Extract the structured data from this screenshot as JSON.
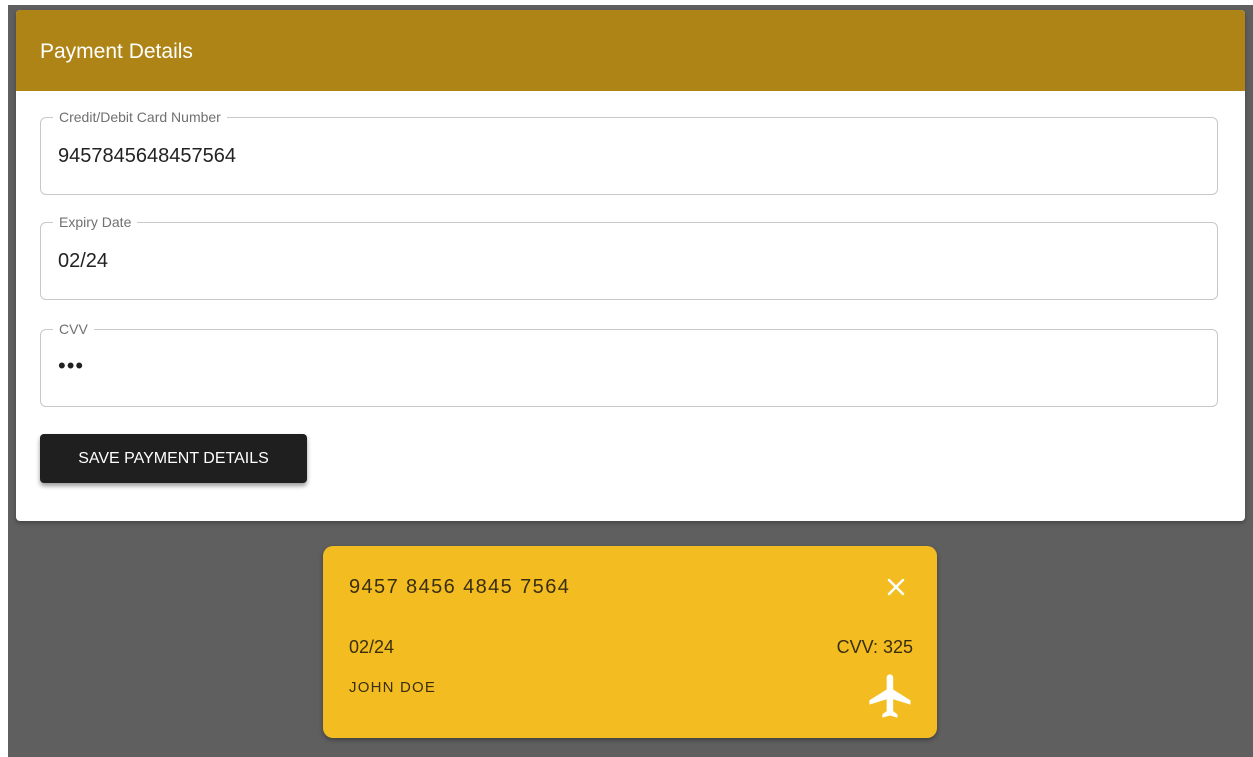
{
  "panel": {
    "title": "Payment Details"
  },
  "fields": {
    "card_number": {
      "label": "Credit/Debit Card Number",
      "value": "9457845648457564"
    },
    "expiry": {
      "label": "Expiry Date",
      "value": "02/24"
    },
    "cvv": {
      "label": "CVV",
      "value": "•••"
    }
  },
  "save_button": {
    "label": "SAVE PAYMENT DETAILS"
  },
  "card_preview": {
    "number": "9457 8456 4845 7564",
    "expiry": "02/24",
    "cvv_text": "CVV: 325",
    "holder": "JOHN DOE",
    "close_icon": "close-icon",
    "brand_icon": "airplane-icon"
  },
  "colors": {
    "header": "#ae8416",
    "card": "#f3bd21",
    "button": "#1f1f1f",
    "background": "#5f5f5f"
  }
}
